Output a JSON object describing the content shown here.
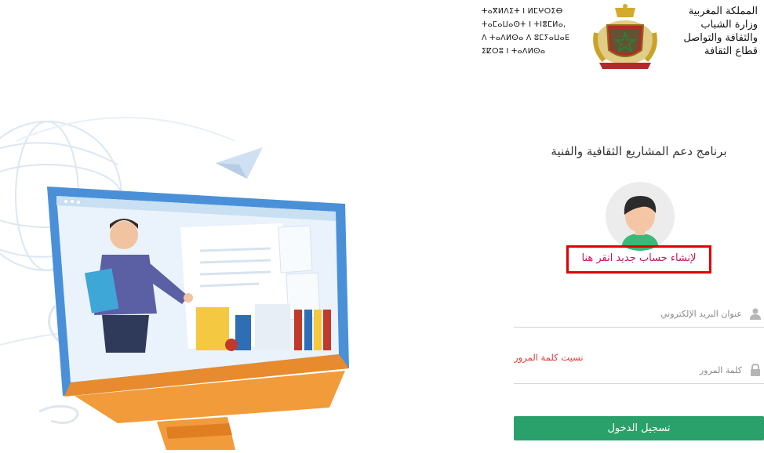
{
  "header": {
    "arabic_lines": [
      "المملكة المغربية",
      "وزارة الشباب",
      "والثقافة والتواصل",
      "قطاع الثقافة"
    ],
    "tifinagh_lines": [
      "ⵜⴰⴳⵍⴷⵉⵜ ⵏ ⵍⵎⵖⵔⵉⴱ",
      "ⵜⴰⵎⴰⵡⴰⵙⵜ ⵏ ⵜⵏⴻⵎⵍⴰ,",
      "ⴷ ⵜⴰⴷⵍⵙⴰ ⴷ ⵓⵎⵢⴰⵡⴰⴹ",
      "ⵉⵇⵔⵓ ⵏ ⵜⴰⴷⵍⵙⴰ"
    ],
    "emblem_icon": "morocco-coat-of-arms"
  },
  "program": {
    "title": "برنامج دعم المشاريع الثقافية والفنية"
  },
  "avatar": {
    "icon": "user-avatar-icon"
  },
  "register": {
    "label": "لإنشاء حساب جديد انقر هنا",
    "highlight_color": "#e10000",
    "text_color": "#c2185b"
  },
  "email": {
    "placeholder": "عنوان البريد الإلكتروني",
    "value": "",
    "icon": "user-icon"
  },
  "forgot": {
    "label": "نسيت كلمة المرور؟"
  },
  "password": {
    "placeholder": "كلمة المرور",
    "value": "",
    "icon": "lock-icon"
  },
  "login": {
    "label": "تسجيل الدخول",
    "color": "#2aa06a"
  },
  "illustration": {
    "icon": "teacher-at-computer-illustration"
  }
}
